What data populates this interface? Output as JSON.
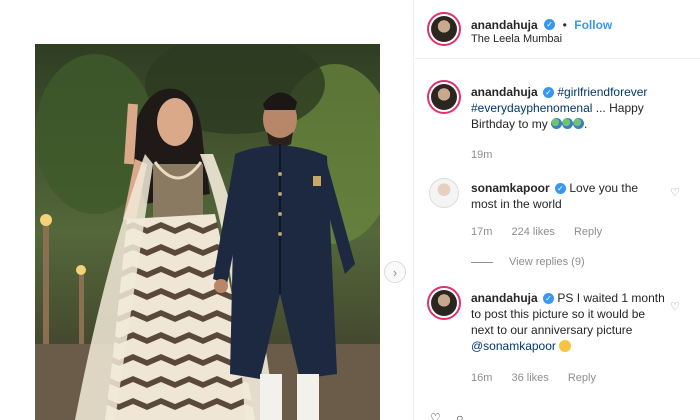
{
  "post": {
    "username": "anandahuja",
    "follow_label": "Follow",
    "separator": "•",
    "location": "The Leela Mumbai"
  },
  "caption": {
    "username": "anandahuja",
    "hashtag1": "#girlfriendforever",
    "hashtag2": "#everydayphenomenal",
    "text": "... Happy Birthday to my",
    "time": "19m"
  },
  "comments": [
    {
      "username": "sonamkapoor",
      "text": "Love you the most in the world",
      "time": "17m",
      "likes": "224 likes",
      "reply_label": "Reply",
      "view_replies": "View replies (9)"
    },
    {
      "username": "anandahuja",
      "text": "PS I waited 1 month to post this picture so it would be next to our anniversary picture",
      "mention": "@sonamkapoor",
      "time": "16m",
      "likes": "36 likes",
      "reply_label": "Reply"
    }
  ],
  "icons": {
    "verified": "verified-badge-icon",
    "heart": "heart-icon",
    "next": "chevron-right-icon"
  },
  "colors": {
    "link": "#3897f0",
    "hashtag": "#00376b",
    "muted": "#8e8e8e",
    "story_ring": "#e1306c"
  }
}
